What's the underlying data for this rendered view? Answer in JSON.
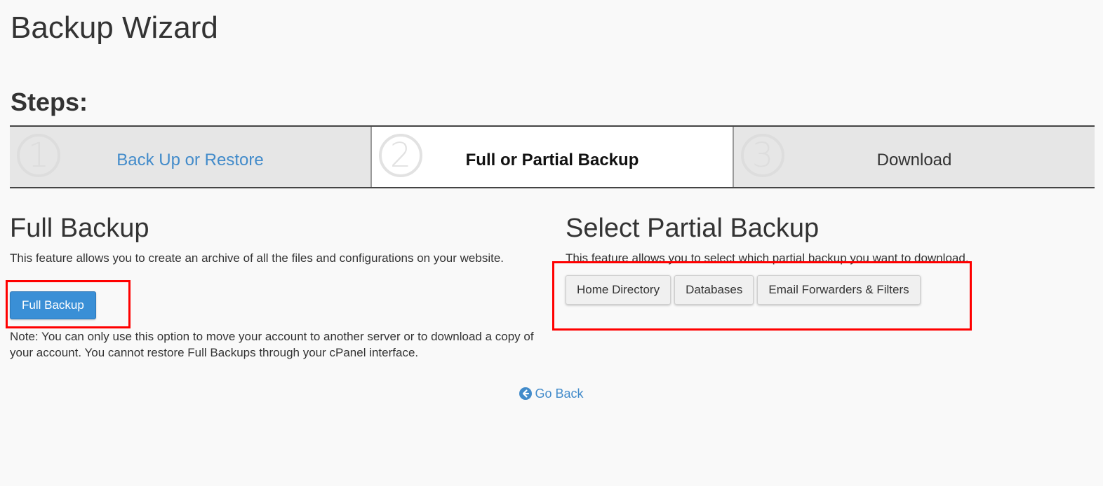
{
  "page": {
    "title": "Backup Wizard"
  },
  "steps": {
    "heading": "Steps:",
    "items": [
      {
        "number": "1",
        "label": "Back Up or Restore",
        "state": "link"
      },
      {
        "number": "2",
        "label": "Full or Partial Backup",
        "state": "current"
      },
      {
        "number": "3",
        "label": "Download",
        "state": "upcoming"
      }
    ]
  },
  "full_backup": {
    "heading": "Full Backup",
    "description": "This feature allows you to create an archive of all the files and configurations on your website.",
    "button_label": "Full Backup",
    "note": "Note: You can only use this option to move your account to another server or to download a copy of your account. You cannot restore Full Backups through your cPanel interface."
  },
  "partial_backup": {
    "heading": "Select Partial Backup",
    "description": "This feature allows you to select which partial backup you want to download.",
    "buttons": [
      {
        "label": "Home Directory"
      },
      {
        "label": "Databases"
      },
      {
        "label": "Email Forwarders & Filters"
      }
    ]
  },
  "footer": {
    "go_back_label": "Go Back",
    "go_back_icon": "arrow-circle-left-icon"
  },
  "colors": {
    "primary_button": "#3a8fd6",
    "link": "#428bca",
    "highlight": "#ff0000",
    "background": "#f9f9f9"
  }
}
